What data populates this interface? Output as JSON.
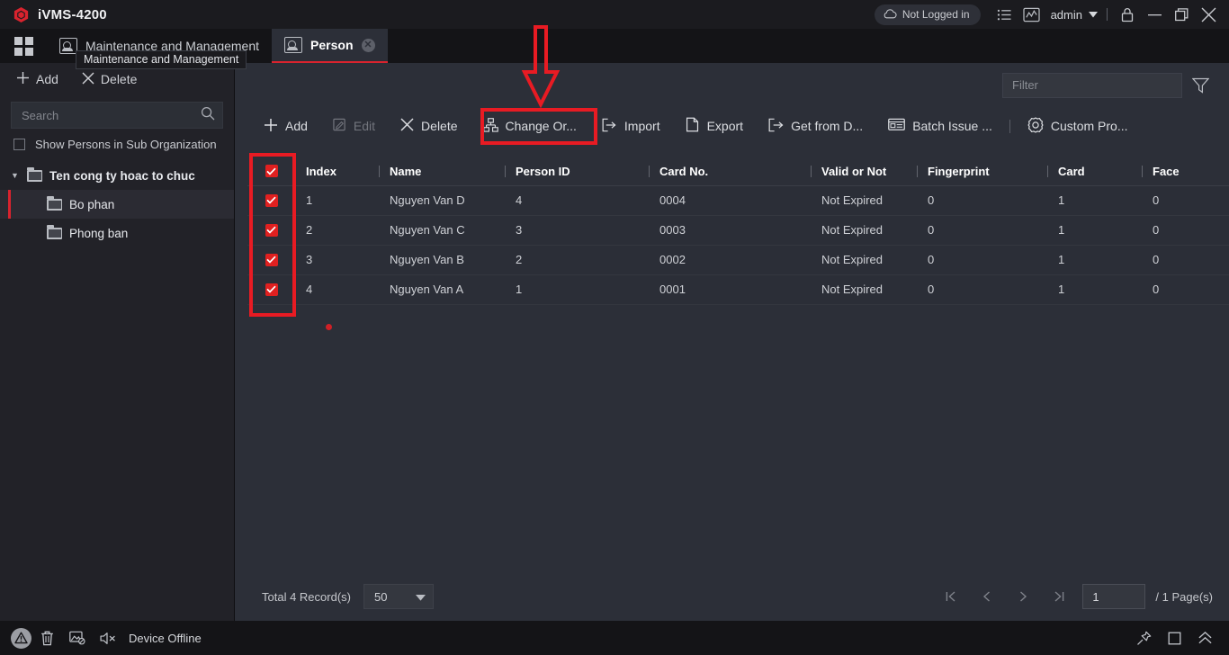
{
  "titlebar": {
    "app_title": "iVMS-4200",
    "logo_icon": "hexagon-logo-icon",
    "cloud_status": "Not Logged in",
    "cloud_icon": "cloud-icon",
    "list_icon": "list-icon",
    "chart_icon": "chart-icon",
    "user_name": "admin",
    "caret_icon": "chevron-down-icon",
    "lock_icon": "lock-icon",
    "minimize_icon": "minimize-icon",
    "maximize_icon": "restore-icon",
    "close_icon": "close-icon"
  },
  "tabbar": {
    "grid_icon": "grid-menu-icon",
    "tabs": [
      {
        "label": "Maintenance and Management",
        "icon": "maintenance-icon",
        "active": false
      },
      {
        "label": "Person",
        "icon": "person-card-icon",
        "active": true,
        "close_icon": "close-circle-icon"
      }
    ],
    "tooltip": "Maintenance and Management"
  },
  "sidebar": {
    "add_label": "Add",
    "add_icon": "plus-icon",
    "delete_label": "Delete",
    "delete_icon": "x-icon",
    "search_placeholder": "Search",
    "search_value": "",
    "search_icon": "search-icon",
    "sub_org_label": "Show Persons in Sub Organization",
    "sub_org_checked": false,
    "tree": [
      {
        "label": "Ten cong ty hoac to chuc",
        "level": 0,
        "expanded": true,
        "selected": false
      },
      {
        "label": "Bo phan",
        "level": 1,
        "selected": true
      },
      {
        "label": "Phong ban",
        "level": 1,
        "selected": false
      }
    ]
  },
  "filter": {
    "placeholder": "Filter",
    "value": "",
    "funnel_icon": "filter-funnel-icon"
  },
  "toolbar": {
    "items": [
      {
        "label": "Add",
        "icon": "plus-icon",
        "disabled": false,
        "highlighted": false
      },
      {
        "label": "Edit",
        "icon": "pencil-square-icon",
        "disabled": true,
        "highlighted": false
      },
      {
        "label": "Delete",
        "icon": "x-icon",
        "disabled": false,
        "highlighted": false
      },
      {
        "label": "Change Or...",
        "icon": "org-tree-icon",
        "disabled": false,
        "highlighted": true
      },
      {
        "label": "Import",
        "icon": "import-arrow-icon",
        "disabled": false,
        "highlighted": false
      },
      {
        "label": "Export",
        "icon": "export-page-icon",
        "disabled": false,
        "highlighted": false
      },
      {
        "label": "Get from D...",
        "icon": "get-from-device-icon",
        "disabled": false,
        "highlighted": false
      },
      {
        "label": "Batch Issue ...",
        "icon": "card-icon",
        "disabled": false,
        "highlighted": false
      },
      {
        "label": "Custom Pro...",
        "icon": "gear-icon",
        "disabled": false,
        "highlighted": false
      }
    ]
  },
  "table": {
    "header_checked": true,
    "columns": [
      "Index",
      "Name",
      "Person ID",
      "Card No.",
      "Valid or Not",
      "Fingerprint",
      "Card",
      "Face"
    ],
    "rows": [
      {
        "checked": true,
        "cells": [
          "1",
          "Nguyen Van D",
          "4",
          "0004",
          "Not Expired",
          "0",
          "1",
          "0"
        ]
      },
      {
        "checked": true,
        "cells": [
          "2",
          "Nguyen Van C",
          "3",
          "0003",
          "Not Expired",
          "0",
          "1",
          "0"
        ]
      },
      {
        "checked": true,
        "cells": [
          "3",
          "Nguyen Van B",
          "2",
          "0002",
          "Not Expired",
          "0",
          "1",
          "0"
        ]
      },
      {
        "checked": true,
        "cells": [
          "4",
          "Nguyen Van A",
          "1",
          "0001",
          "Not Expired",
          "0",
          "1",
          "0"
        ]
      }
    ]
  },
  "pager": {
    "total_label": "Total 4 Record(s)",
    "page_size": "50",
    "page_size_caret": "chevron-down-icon",
    "first_icon": "first-page-icon",
    "prev_icon": "prev-page-icon",
    "next_icon": "next-page-icon",
    "last_icon": "last-page-icon",
    "current_page": "1",
    "total_pages": "/ 1 Page(s)"
  },
  "statusbar": {
    "warning_icon": "warning-triangle-icon",
    "trash_icon": "trash-icon",
    "image-block_icon": "image-blocked-icon",
    "mute_icon": "speaker-mute-icon",
    "status_text": "Device Offline",
    "pin_icon": "pin-icon",
    "square_icon": "square-icon",
    "collapse_icon": "chevron-double-up-icon"
  },
  "annotations": {
    "accent_red": "#e81b23",
    "arrow_label": "down-arrow-annotation",
    "checkbox_box_label": "checkbox-column-highlight",
    "change_org_box_label": "change-org-highlight"
  }
}
